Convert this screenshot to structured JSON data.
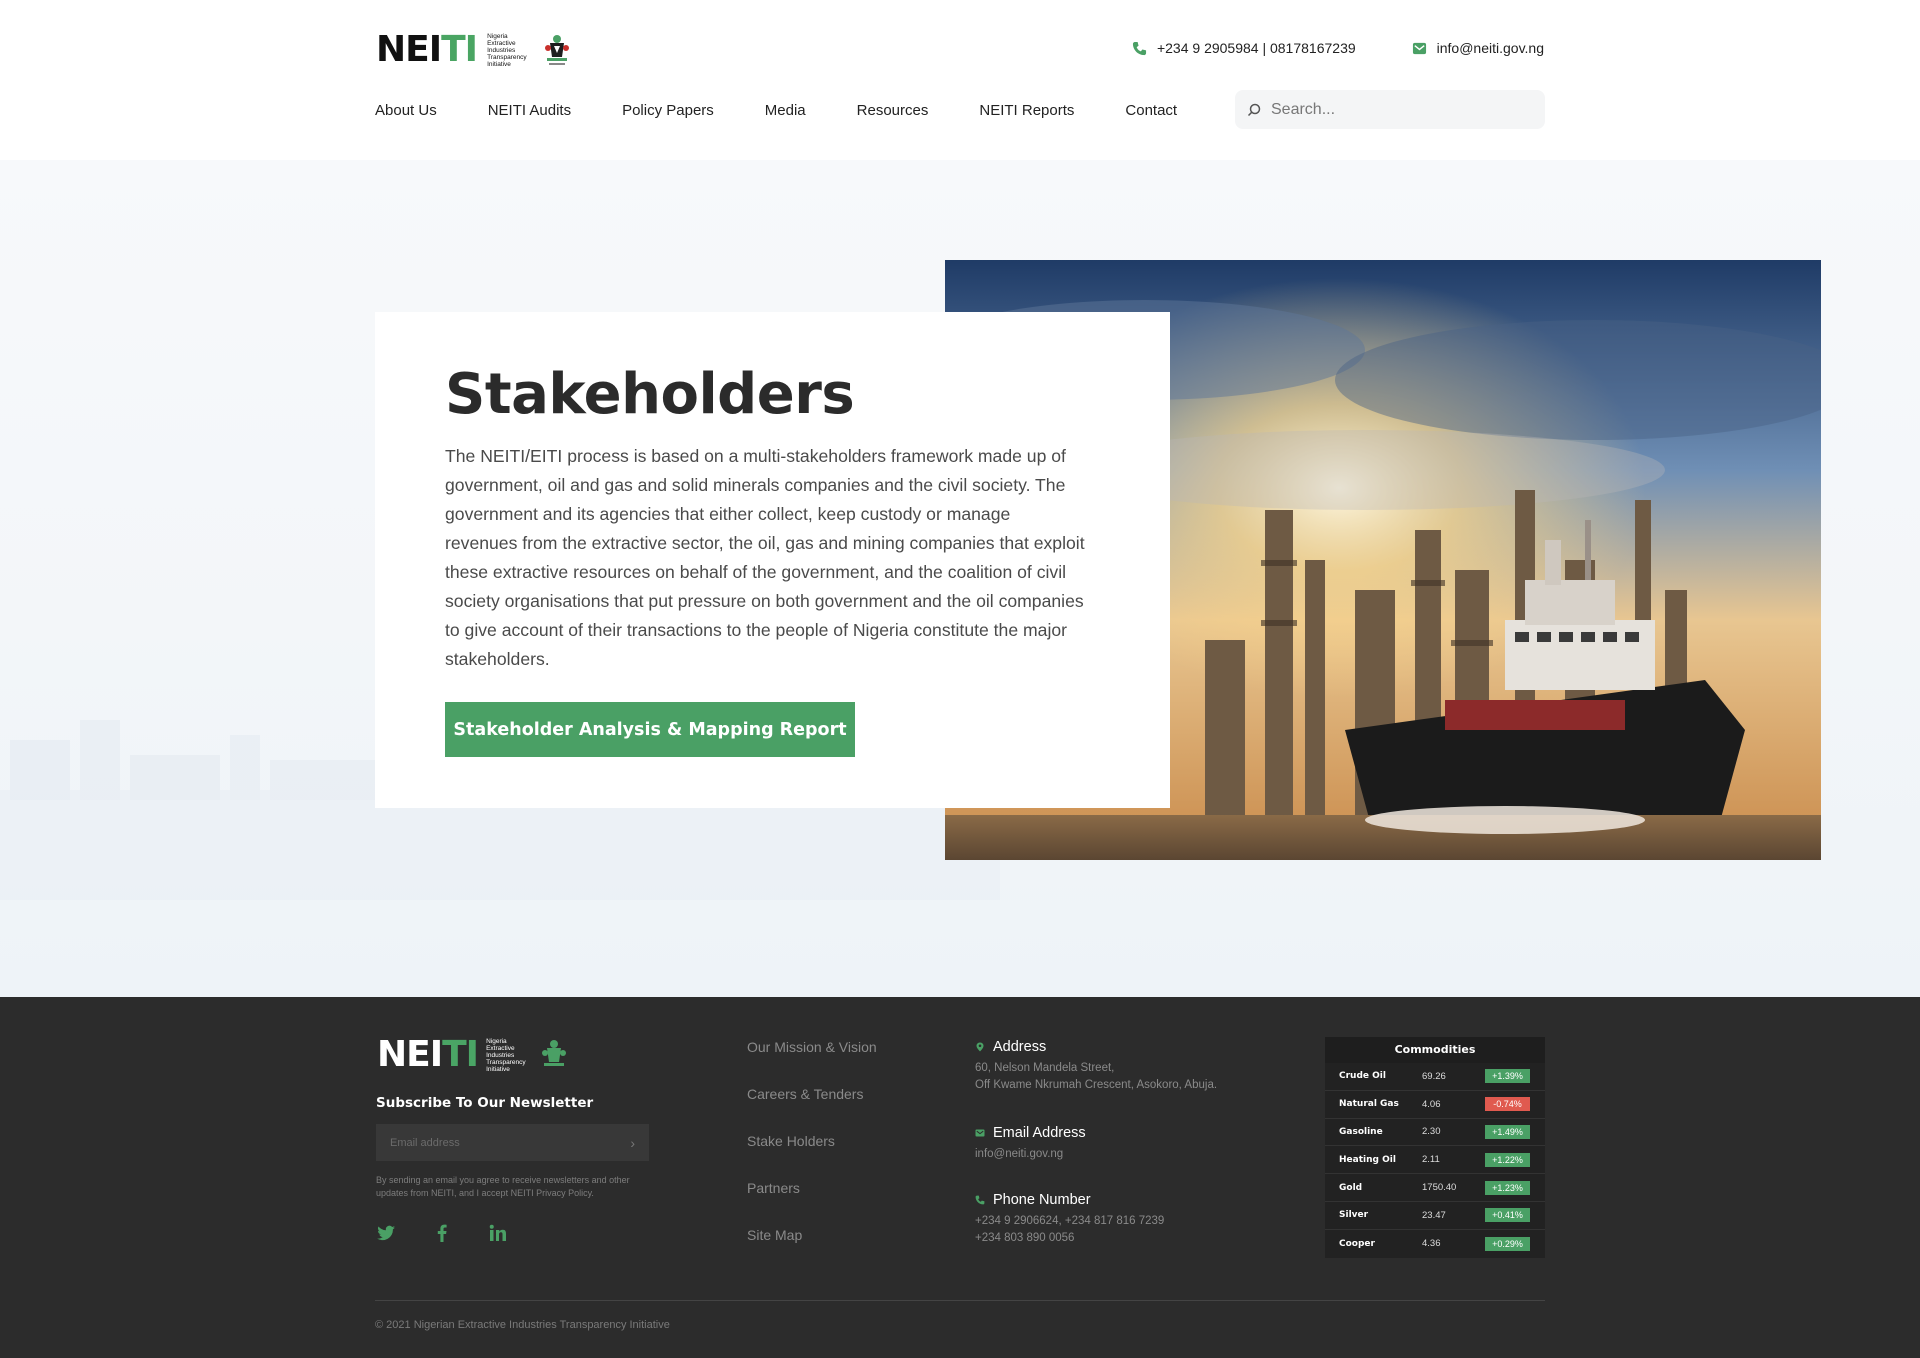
{
  "header": {
    "logo_text_black": "NEI",
    "logo_text_green": "TI",
    "logo_subtitle": "Nigeria Extractive Industries Transparency Initiative",
    "phone": "+234 9 2905984 | 08178167239",
    "email": "info@neiti.gov.ng"
  },
  "nav": {
    "items": [
      "About Us",
      "NEITI Audits",
      "Policy Papers",
      "Media",
      "Resources",
      "NEITI Reports",
      "Contact"
    ]
  },
  "search": {
    "placeholder": "Search..."
  },
  "hero": {
    "title": "Stakeholders",
    "body": "The NEITI/EITI process is based on a multi-stakeholders framework made up of government, oil and gas and solid minerals companies and the civil society. The government and its agencies that either collect, keep custody or manage revenues from the extractive sector, the oil, gas and mining companies that exploit these extractive resources on behalf of the government, and the coalition of civil society organisations that put pressure on both government and the oil companies to give account of their transactions to the people of Nigeria constitute the major stakeholders.",
    "cta_label": "Stakeholder Analysis & Mapping Report"
  },
  "footer": {
    "newsletter_title": "Subscribe To Our Newsletter",
    "email_placeholder": "Email address",
    "fine_print": "By sending an email you agree to receive newsletters and other updates from NEITI, and I accept NEITI Privacy Policy.",
    "links": [
      "Our Mission & Vision",
      "Careers & Tenders",
      "Stake Holders",
      "Partners",
      "Site Map"
    ],
    "address_title": "Address",
    "address_line1": "60, Nelson Mandela Street,",
    "address_line2": "Off Kwame Nkrumah Crescent, Asokoro, Abuja.",
    "email_title": "Email Address",
    "email": "info@neiti.gov.ng",
    "phone_title": "Phone Number",
    "phone_line1": "+234 9 2906624, +234 817 816 7239",
    "phone_line2": "+234 803 890 0056",
    "copyright": "© 2021 Nigerian Extractive Industries Transparency Initiative"
  },
  "commodities": {
    "title": "Commodities",
    "rows": [
      {
        "name": "Crude Oil",
        "price": "69.26",
        "change": "+1.39%",
        "direction": "up"
      },
      {
        "name": "Natural Gas",
        "price": "4.06",
        "change": "-0.74%",
        "direction": "down"
      },
      {
        "name": "Gasoline",
        "price": "2.30",
        "change": "+1.49%",
        "direction": "up"
      },
      {
        "name": "Heating Oil",
        "price": "2.11",
        "change": "+1.22%",
        "direction": "up"
      },
      {
        "name": "Gold",
        "price": "1750.40",
        "change": "+1.23%",
        "direction": "up"
      },
      {
        "name": "Silver",
        "price": "23.47",
        "change": "+0.41%",
        "direction": "up"
      },
      {
        "name": "Cooper",
        "price": "4.36",
        "change": "+0.29%",
        "direction": "up"
      }
    ]
  },
  "colors": {
    "brand_green": "#4aa065",
    "negative_red": "#e05a4f",
    "footer_bg": "#2c2c2c"
  },
  "icons": {
    "phone": "phone-icon",
    "email": "envelope-icon",
    "search": "search-icon",
    "location": "location-pin-icon",
    "twitter": "twitter-icon",
    "facebook": "facebook-icon",
    "linkedin": "linkedin-icon"
  }
}
